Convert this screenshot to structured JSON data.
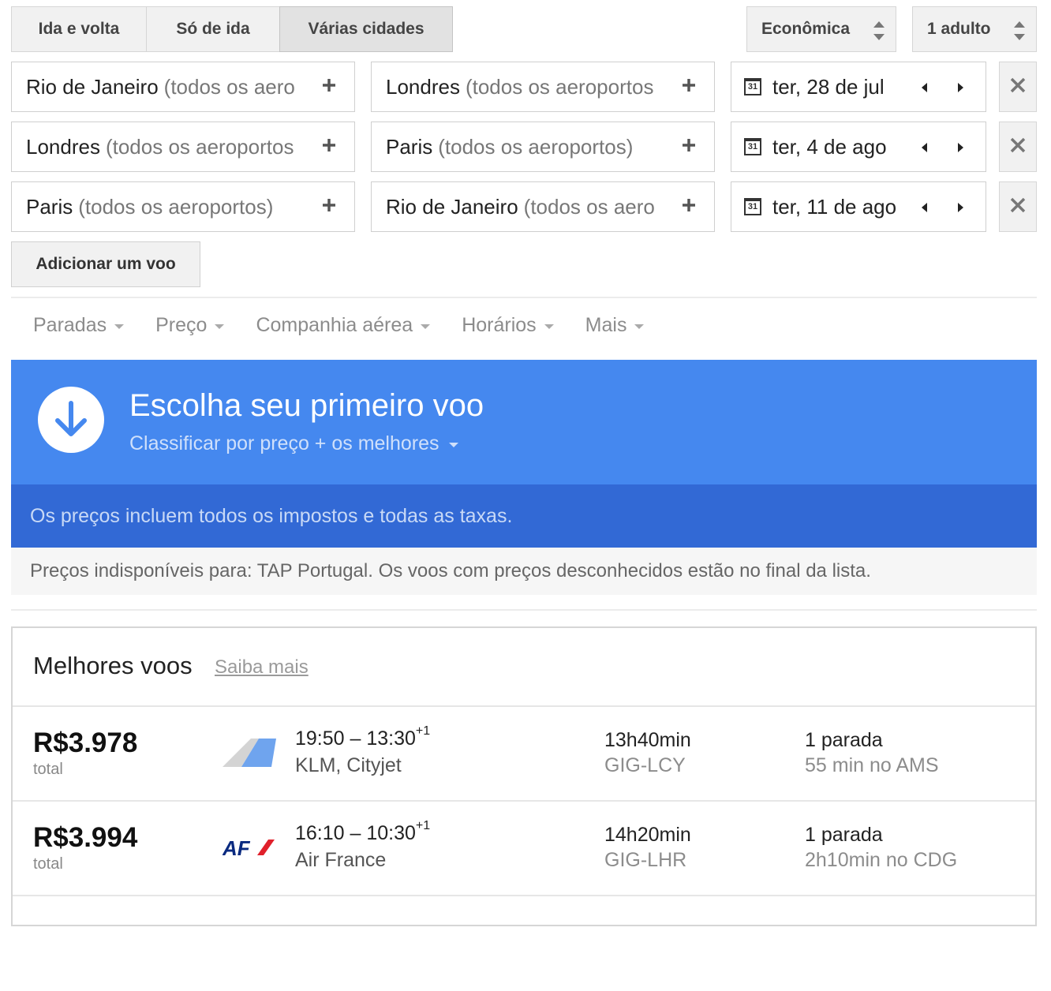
{
  "trip_types": [
    {
      "label": "Ida e volta",
      "active": false
    },
    {
      "label": "Só de ida",
      "active": false
    },
    {
      "label": "Várias cidades",
      "active": true
    }
  ],
  "cabin_class": "Econômica",
  "passengers": "1 adulto",
  "legs": [
    {
      "from": "Rio de Janeiro",
      "from_sub": "(todos os aero",
      "to": "Londres",
      "to_sub": "(todos os aeroportos",
      "date": "ter, 28 de jul"
    },
    {
      "from": "Londres",
      "from_sub": "(todos os aeroportos",
      "to": "Paris",
      "to_sub": "(todos os aeroportos)",
      "date": "ter, 4 de ago"
    },
    {
      "from": "Paris",
      "from_sub": "(todos os aeroportos)",
      "to": "Rio de Janeiro",
      "to_sub": "(todos os aero",
      "date": "ter, 11 de ago"
    }
  ],
  "calendar_icon_text": "31",
  "add_flight_label": "Adicionar um voo",
  "filters": [
    "Paradas",
    "Preço",
    "Companhia aérea",
    "Horários",
    "Mais"
  ],
  "banner": {
    "title": "Escolha seu primeiro voo",
    "sort_label": "Classificar por preço + os melhores",
    "tax_note": "Os preços incluem todos os impostos e todas as taxas.",
    "notice": "Preços indisponíveis para: TAP Portugal. Os voos com preços desconhecidos estão no final da lista."
  },
  "results": {
    "title": "Melhores voos",
    "learn_more": "Saiba mais",
    "flights": [
      {
        "price": "R$3.978",
        "price_note": "total",
        "logo": "klm-cityjet-logo",
        "depart": "19:50",
        "arrive": "13:30",
        "day_offset": "+1",
        "airline": "KLM, Cityjet",
        "duration": "13h40min",
        "route": "GIG-LCY",
        "stops": "1 parada",
        "layover": "55 min no AMS"
      },
      {
        "price": "R$3.994",
        "price_note": "total",
        "logo": "air-france-logo",
        "logo_text": "AF",
        "depart": "16:10",
        "arrive": "10:30",
        "day_offset": "+1",
        "airline": "Air France",
        "duration": "14h20min",
        "route": "GIG-LHR",
        "stops": "1 parada",
        "layover": "2h10min no CDG"
      }
    ]
  },
  "colors": {
    "banner": "#4588ef",
    "banner_dark": "#3269d5"
  }
}
